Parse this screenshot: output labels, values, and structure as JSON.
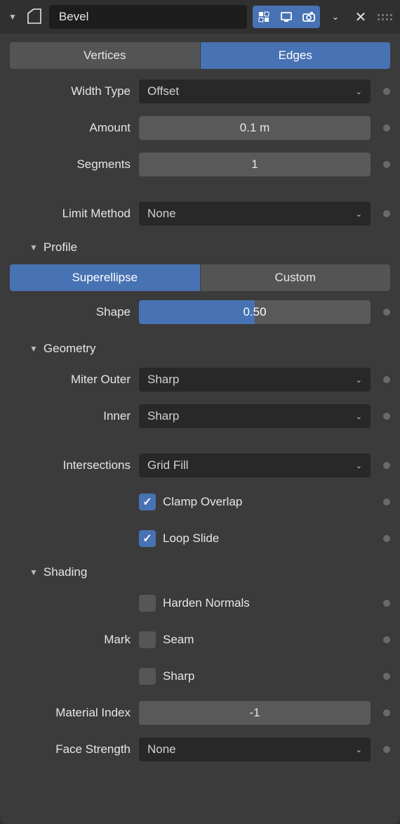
{
  "header": {
    "modifier_name": "Bevel",
    "icons": {
      "edit": "edit-mode-icon",
      "display": "display-icon",
      "render": "camera-icon"
    }
  },
  "affect": {
    "options": [
      "Vertices",
      "Edges"
    ],
    "active": "Edges"
  },
  "width_type": {
    "label": "Width Type",
    "value": "Offset"
  },
  "amount": {
    "label": "Amount",
    "value": "0.1 m"
  },
  "segments": {
    "label": "Segments",
    "value": "1"
  },
  "limit_method": {
    "label": "Limit Method",
    "value": "None"
  },
  "profile": {
    "title": "Profile",
    "options": [
      "Superellipse",
      "Custom"
    ],
    "active": "Superellipse",
    "shape": {
      "label": "Shape",
      "value": "0.50",
      "fill_pct": 50
    }
  },
  "geometry": {
    "title": "Geometry",
    "miter_outer": {
      "label": "Miter Outer",
      "value": "Sharp"
    },
    "miter_inner": {
      "label": "Inner",
      "value": "Sharp"
    },
    "intersections": {
      "label": "Intersections",
      "value": "Grid Fill"
    },
    "clamp_overlap": {
      "label": "Clamp Overlap",
      "checked": true
    },
    "loop_slide": {
      "label": "Loop Slide",
      "checked": true
    }
  },
  "shading": {
    "title": "Shading",
    "harden_normals": {
      "label": "Harden Normals",
      "checked": false
    },
    "mark_label": "Mark",
    "mark_seam": {
      "label": "Seam",
      "checked": false
    },
    "mark_sharp": {
      "label": "Sharp",
      "checked": false
    },
    "material_index": {
      "label": "Material Index",
      "value": "-1"
    },
    "face_strength": {
      "label": "Face Strength",
      "value": "None"
    }
  }
}
